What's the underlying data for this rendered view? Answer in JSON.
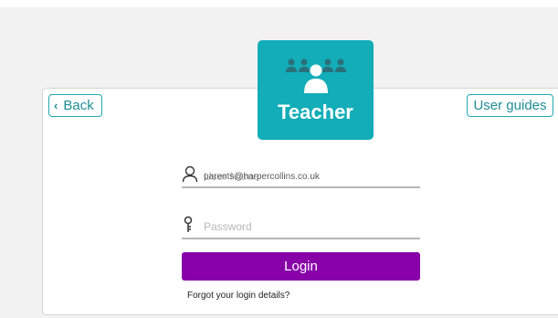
{
  "nav": {
    "back_label": "Back",
    "user_guides_label": "User guides"
  },
  "badge": {
    "label": "Teacher",
    "icon": "group-of-people-icon",
    "color": "#12adb8"
  },
  "login_form": {
    "username": {
      "placeholder": "User Name",
      "value": "parents@harpercollins.co.uk",
      "icon": "person-icon"
    },
    "password": {
      "placeholder": "Password",
      "value": "",
      "icon": "key-icon"
    },
    "login_label": "Login",
    "login_color": "#8800a8",
    "forgot_label": "Forgot your login details?"
  }
}
